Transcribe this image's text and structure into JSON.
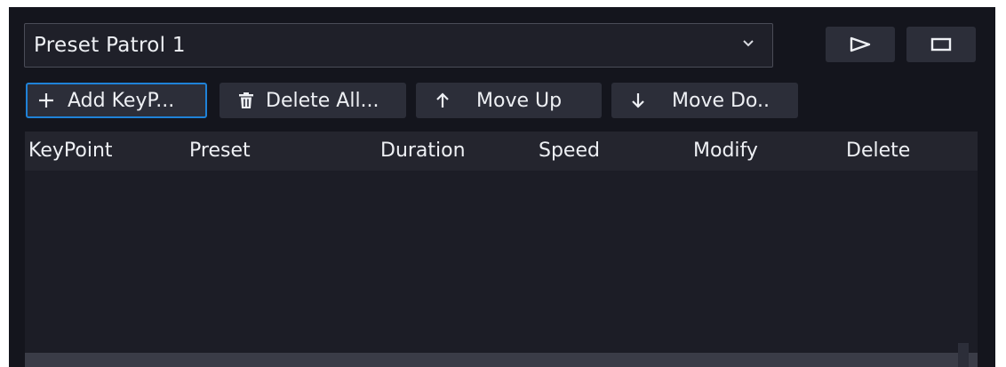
{
  "patrol_select": {
    "value": "Preset Patrol 1",
    "chevron_icon": "chevron-down-icon"
  },
  "controls": {
    "play_icon": "play-icon",
    "stop_icon": "stop-icon"
  },
  "toolbar": {
    "add_label": "Add KeyP...",
    "add_icon": "plus-icon",
    "delete_all_label": "Delete All...",
    "delete_all_icon": "trash-icon",
    "move_up_label": "Move Up",
    "move_up_icon": "arrow-up-icon",
    "move_down_label": "Move Do..",
    "move_down_icon": "arrow-down-icon"
  },
  "table": {
    "columns": [
      "KeyPoint",
      "Preset",
      "Duration",
      "Speed",
      "Modify",
      "Delete"
    ],
    "rows": []
  },
  "colors": {
    "panel_bg": "#14151d",
    "accent_border": "#1f82d8",
    "button_bg": "#2c2e39",
    "text": "#eef0f4"
  }
}
